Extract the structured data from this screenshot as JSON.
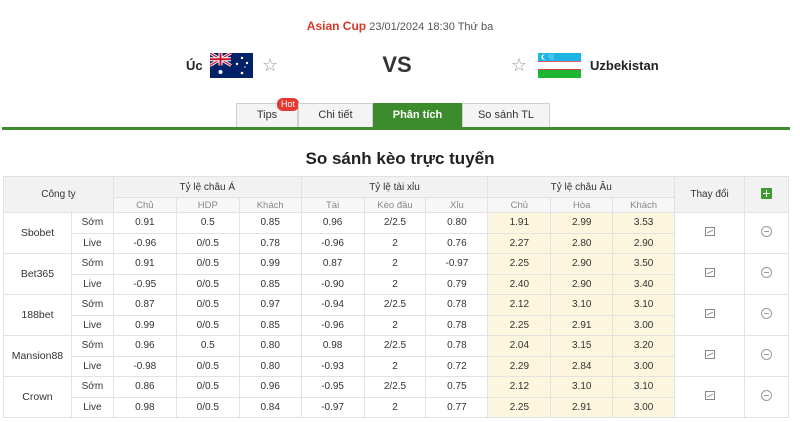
{
  "match": {
    "league": "Asian Cup",
    "datetime": "23/01/2024 18:30 Thứ ba",
    "home_team": "Úc",
    "away_team": "Uzbekistan",
    "vs": "VS"
  },
  "tabs": [
    {
      "label": "Tips",
      "badge": "Hot",
      "active": false
    },
    {
      "label": "Chi tiết",
      "active": false
    },
    {
      "label": "Phân tích",
      "active": true
    },
    {
      "label": "So sánh TL",
      "active": false
    }
  ],
  "section_title": "So sánh kèo trực tuyến",
  "table": {
    "headers": {
      "company": "Công ty",
      "asian": "Tỷ lệ châu Á",
      "total": "Tỷ lệ tài xỉu",
      "euro": "Tỷ lệ châu Âu",
      "change": "Thay đổi"
    },
    "subheaders": {
      "asian": [
        "Chủ",
        "HDP",
        "Khách"
      ],
      "total": [
        "Tài",
        "Kèo đầu",
        "Xỉu"
      ],
      "euro": [
        "Chủ",
        "Hòa",
        "Khách"
      ]
    },
    "rows": [
      {
        "bookmaker": "Sbobet",
        "early": {
          "tag": "Sớm",
          "asian": [
            "0.91",
            "0.5",
            "0.85"
          ],
          "total": [
            "0.96",
            "2/2.5",
            "0.80"
          ],
          "euro": [
            "1.91",
            "2.99",
            "3.53"
          ]
        },
        "live": {
          "tag": "Live",
          "asian": [
            "-0.96",
            "0/0.5",
            "0.78"
          ],
          "total": [
            "-0.96",
            "2",
            "0.76"
          ],
          "euro": [
            "2.27",
            "2.80",
            "2.90"
          ]
        }
      },
      {
        "bookmaker": "Bet365",
        "early": {
          "tag": "Sớm",
          "asian": [
            "0.91",
            "0/0.5",
            "0.99"
          ],
          "total": [
            "0.87",
            "2",
            "-0.97"
          ],
          "euro": [
            "2.25",
            "2.90",
            "3.50"
          ]
        },
        "live": {
          "tag": "Live",
          "asian": [
            "-0.95",
            "0/0.5",
            "0.85"
          ],
          "total": [
            "-0.90",
            "2",
            "0.79"
          ],
          "euro": [
            "2.40",
            "2.90",
            "3.40"
          ]
        }
      },
      {
        "bookmaker": "188bet",
        "early": {
          "tag": "Sớm",
          "asian": [
            "0.87",
            "0/0.5",
            "0.97"
          ],
          "total": [
            "-0.94",
            "2/2.5",
            "0.78"
          ],
          "euro": [
            "2.12",
            "3.10",
            "3.10"
          ]
        },
        "live": {
          "tag": "Live",
          "asian": [
            "0.99",
            "0/0.5",
            "0.85"
          ],
          "total": [
            "-0.96",
            "2",
            "0.78"
          ],
          "euro": [
            "2.25",
            "2.91",
            "3.00"
          ]
        }
      },
      {
        "bookmaker": "Mansion88",
        "early": {
          "tag": "Sớm",
          "asian": [
            "0.96",
            "0.5",
            "0.80"
          ],
          "total": [
            "0.98",
            "2/2.5",
            "0.78"
          ],
          "euro": [
            "2.04",
            "3.15",
            "3.20"
          ]
        },
        "live": {
          "tag": "Live",
          "asian": [
            "-0.98",
            "0/0.5",
            "0.80"
          ],
          "total": [
            "-0.93",
            "2",
            "0.72"
          ],
          "euro": [
            "2.29",
            "2.84",
            "3.00"
          ]
        }
      },
      {
        "bookmaker": "Crown",
        "early": {
          "tag": "Sớm",
          "asian": [
            "0.86",
            "0/0.5",
            "0.96"
          ],
          "total": [
            "-0.95",
            "2/2.5",
            "0.75"
          ],
          "euro": [
            "2.12",
            "3.10",
            "3.10"
          ]
        },
        "live": {
          "tag": "Live",
          "asian": [
            "0.98",
            "0/0.5",
            "0.84"
          ],
          "total": [
            "-0.97",
            "2",
            "0.77"
          ],
          "euro": [
            "2.25",
            "2.91",
            "3.00"
          ]
        }
      }
    ]
  },
  "colors": {
    "accent_green": "#3c8c2e",
    "league_red": "#d9362b",
    "euro_bg": "#fcf6de"
  }
}
